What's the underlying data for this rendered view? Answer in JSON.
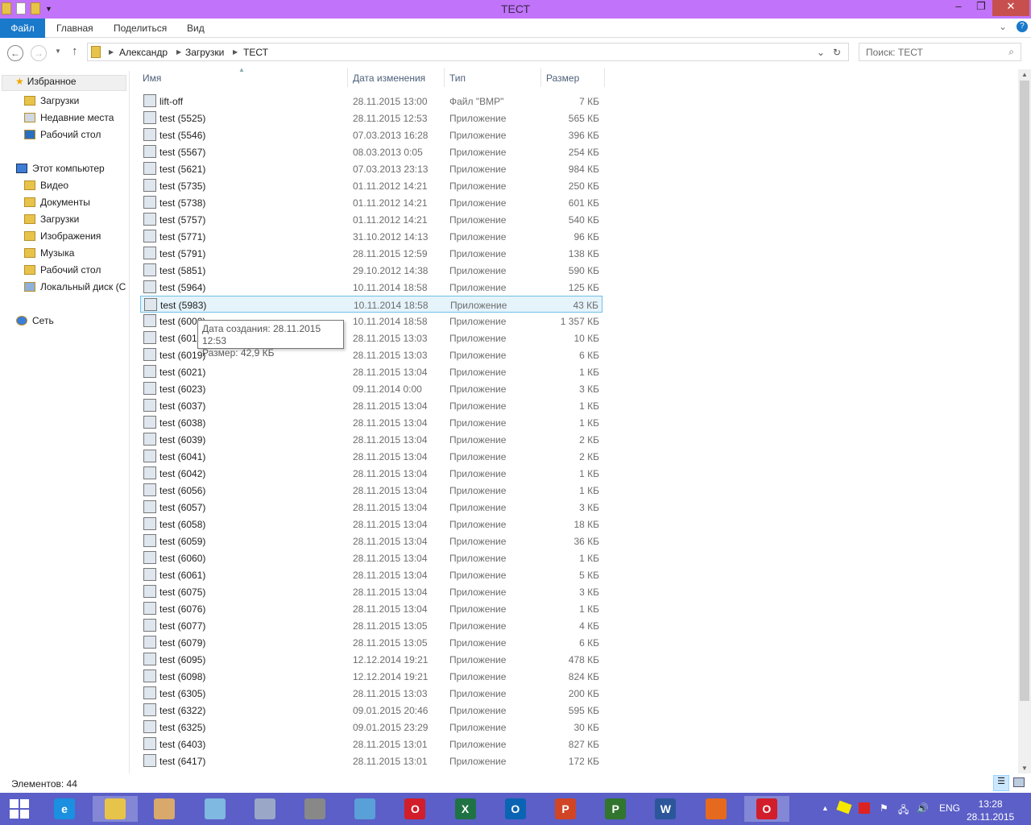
{
  "window": {
    "title": "ТЕСТ"
  },
  "ribbon": {
    "file": "Файл",
    "tabs": [
      "Главная",
      "Поделиться",
      "Вид"
    ]
  },
  "address": {
    "crumbs": [
      "Александр",
      "Загрузки",
      "ТЕСТ"
    ],
    "search_placeholder": "Поиск: ТЕСТ"
  },
  "nav": {
    "favorites": "Избранное",
    "fav_items": [
      "Загрузки",
      "Недавние места",
      "Рабочий стол"
    ],
    "computer": "Этот компьютер",
    "comp_items": [
      "Видео",
      "Документы",
      "Загрузки",
      "Изображения",
      "Музыка",
      "Рабочий стол",
      "Локальный диск (C"
    ],
    "network": "Сеть"
  },
  "columns": {
    "name": "Имя",
    "date": "Дата изменения",
    "type": "Тип",
    "size": "Размер"
  },
  "files": [
    [
      "lift-off",
      "28.11.2015 13:00",
      "Файл \"BMP\"",
      "7 КБ"
    ],
    [
      "test (5525)",
      "28.11.2015 12:53",
      "Приложение",
      "565 КБ"
    ],
    [
      "test (5546)",
      "07.03.2013 16:28",
      "Приложение",
      "396 КБ"
    ],
    [
      "test (5567)",
      "08.03.2013 0:05",
      "Приложение",
      "254 КБ"
    ],
    [
      "test (5621)",
      "07.03.2013 23:13",
      "Приложение",
      "984 КБ"
    ],
    [
      "test (5735)",
      "01.11.2012 14:21",
      "Приложение",
      "250 КБ"
    ],
    [
      "test (5738)",
      "01.11.2012 14:21",
      "Приложение",
      "601 КБ"
    ],
    [
      "test (5757)",
      "01.11.2012 14:21",
      "Приложение",
      "540 КБ"
    ],
    [
      "test (5771)",
      "31.10.2012 14:13",
      "Приложение",
      "96 КБ"
    ],
    [
      "test (5791)",
      "28.11.2015 12:59",
      "Приложение",
      "138 КБ"
    ],
    [
      "test (5851)",
      "29.10.2012 14:38",
      "Приложение",
      "590 КБ"
    ],
    [
      "test (5964)",
      "10.11.2014 18:58",
      "Приложение",
      "125 КБ"
    ],
    [
      "test (5983)",
      "10.11.2014 18:58",
      "Приложение",
      "43 КБ"
    ],
    [
      "test (6000)",
      "10.11.2014 18:58",
      "Приложение",
      "1 357 КБ"
    ],
    [
      "test (6018)",
      "28.11.2015 13:03",
      "Приложение",
      "10 КБ"
    ],
    [
      "test (6019)",
      "28.11.2015 13:03",
      "Приложение",
      "6 КБ"
    ],
    [
      "test (6021)",
      "28.11.2015 13:04",
      "Приложение",
      "1 КБ"
    ],
    [
      "test (6023)",
      "09.11.2014 0:00",
      "Приложение",
      "3 КБ"
    ],
    [
      "test (6037)",
      "28.11.2015 13:04",
      "Приложение",
      "1 КБ"
    ],
    [
      "test (6038)",
      "28.11.2015 13:04",
      "Приложение",
      "1 КБ"
    ],
    [
      "test (6039)",
      "28.11.2015 13:04",
      "Приложение",
      "2 КБ"
    ],
    [
      "test (6041)",
      "28.11.2015 13:04",
      "Приложение",
      "2 КБ"
    ],
    [
      "test (6042)",
      "28.11.2015 13:04",
      "Приложение",
      "1 КБ"
    ],
    [
      "test (6056)",
      "28.11.2015 13:04",
      "Приложение",
      "1 КБ"
    ],
    [
      "test (6057)",
      "28.11.2015 13:04",
      "Приложение",
      "3 КБ"
    ],
    [
      "test (6058)",
      "28.11.2015 13:04",
      "Приложение",
      "18 КБ"
    ],
    [
      "test (6059)",
      "28.11.2015 13:04",
      "Приложение",
      "36 КБ"
    ],
    [
      "test (6060)",
      "28.11.2015 13:04",
      "Приложение",
      "1 КБ"
    ],
    [
      "test (6061)",
      "28.11.2015 13:04",
      "Приложение",
      "5 КБ"
    ],
    [
      "test (6075)",
      "28.11.2015 13:04",
      "Приложение",
      "3 КБ"
    ],
    [
      "test (6076)",
      "28.11.2015 13:04",
      "Приложение",
      "1 КБ"
    ],
    [
      "test (6077)",
      "28.11.2015 13:05",
      "Приложение",
      "4 КБ"
    ],
    [
      "test (6079)",
      "28.11.2015 13:05",
      "Приложение",
      "6 КБ"
    ],
    [
      "test (6095)",
      "12.12.2014 19:21",
      "Приложение",
      "478 КБ"
    ],
    [
      "test (6098)",
      "12.12.2014 19:21",
      "Приложение",
      "824 КБ"
    ],
    [
      "test (6305)",
      "28.11.2015 13:03",
      "Приложение",
      "200 КБ"
    ],
    [
      "test (6322)",
      "09.01.2015 20:46",
      "Приложение",
      "595 КБ"
    ],
    [
      "test (6325)",
      "09.01.2015 23:29",
      "Приложение",
      "30 КБ"
    ],
    [
      "test (6403)",
      "28.11.2015 13:01",
      "Приложение",
      "827 КБ"
    ],
    [
      "test (6417)",
      "28.11.2015 13:01",
      "Приложение",
      "172 КБ"
    ]
  ],
  "selected_index": 12,
  "tooltip": {
    "created": "Дата создания: 28.11.2015 12:53",
    "size": "Размер: 42,9 КБ"
  },
  "status": "Элементов: 44",
  "taskbar": {
    "apps": [
      {
        "name": "ie",
        "label": "e",
        "color": "#1b8fe0"
      },
      {
        "name": "explorer",
        "label": "",
        "color": "#e8c34a"
      },
      {
        "name": "paint",
        "label": "",
        "color": "#d9a86b"
      },
      {
        "name": "notepad",
        "label": "",
        "color": "#7fb8e0"
      },
      {
        "name": "taskmgr",
        "label": "",
        "color": "#9aa7c7"
      },
      {
        "name": "calc",
        "label": "",
        "color": "#888"
      },
      {
        "name": "control-panel",
        "label": "",
        "color": "#5aa0d8"
      },
      {
        "name": "opera",
        "label": "O",
        "color": "#d21d2a"
      },
      {
        "name": "excel",
        "label": "X",
        "color": "#1f7244"
      },
      {
        "name": "outlook",
        "label": "O",
        "color": "#0a64b4"
      },
      {
        "name": "powerpoint",
        "label": "P",
        "color": "#d04525"
      },
      {
        "name": "project",
        "label": "P",
        "color": "#31752f"
      },
      {
        "name": "word",
        "label": "W",
        "color": "#2b579a"
      },
      {
        "name": "firefox",
        "label": "",
        "color": "#e66a1e"
      },
      {
        "name": "opera-active",
        "label": "O",
        "color": "#d21d2a"
      }
    ],
    "lang": "ENG",
    "time": "13:28",
    "date": "28.11.2015"
  }
}
